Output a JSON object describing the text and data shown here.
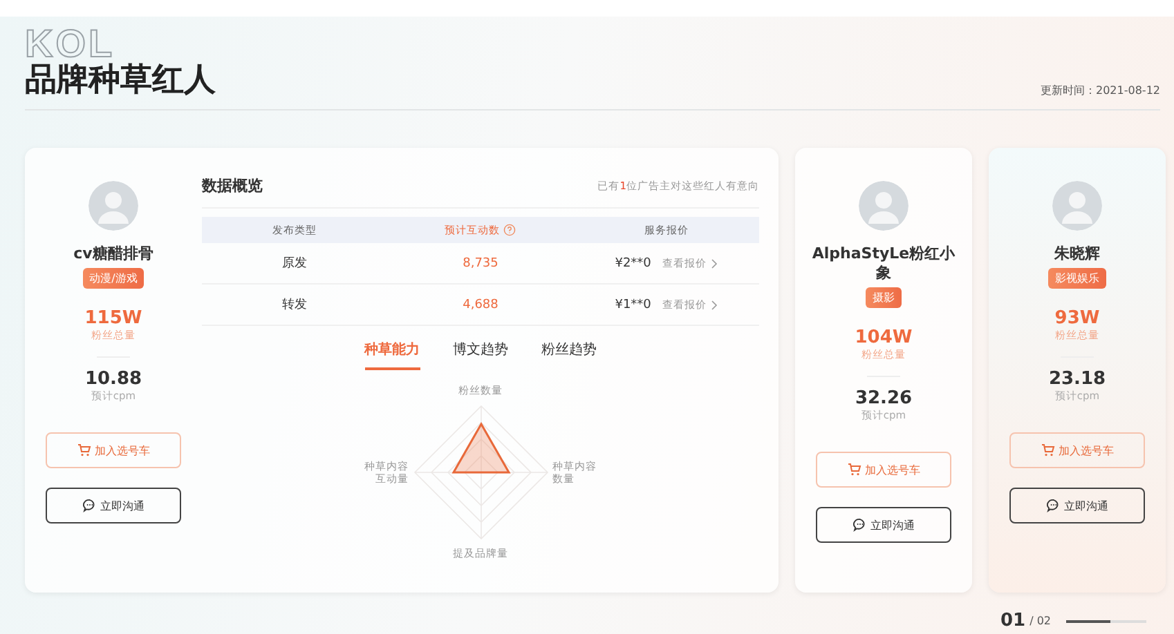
{
  "header": {
    "decoration": "KOL",
    "title": "品牌种草红人",
    "update_time": "更新时间：2021-08-12"
  },
  "influencers": [
    {
      "name": "cv糖醋排骨",
      "tag": "动漫/游戏",
      "fans": "115W",
      "fans_label": "粉丝总量",
      "cpm": "10.88",
      "cpm_label": "预计cpm",
      "cart_button": "加入选号车",
      "chat_button": "立即沟通"
    },
    {
      "name": "AlphaStyLe粉红小象",
      "tag": "摄影",
      "fans": "104W",
      "fans_label": "粉丝总量",
      "cpm": "32.26",
      "cpm_label": "预计cpm",
      "cart_button": "加入选号车",
      "chat_button": "立即沟通"
    },
    {
      "name": "朱晓辉",
      "tag": "影视娱乐",
      "fans": "93W",
      "fans_label": "粉丝总量",
      "cpm": "23.18",
      "cpm_label": "预计cpm",
      "cart_button": "加入选号车",
      "chat_button": "立即沟通"
    }
  ],
  "overview": {
    "title": "数据概览",
    "note": "已有**1**位广告主对这些红人有意向",
    "columns": [
      "发布类型",
      "预计互动数",
      "服务报价"
    ],
    "rows": [
      {
        "type": "原发",
        "interactions": "8,735",
        "price": "¥2**0",
        "link": "查看报价"
      },
      {
        "type": "转发",
        "interactions": "4,688",
        "price": "¥1**0",
        "link": "查看报价"
      }
    ],
    "tabs": [
      {
        "label": "种草能力",
        "selected": true
      },
      {
        "label": "博文趋势",
        "selected": false
      },
      {
        "label": "粉丝趋势",
        "selected": false
      }
    ],
    "radar_labels": {
      "top": "粉丝数量",
      "left": "种草内容互动量",
      "right": "种草内容数量",
      "bottom": "提及品牌量"
    }
  },
  "pager": {
    "current": "01",
    "total": "/ 02",
    "level": 0.55
  }
}
